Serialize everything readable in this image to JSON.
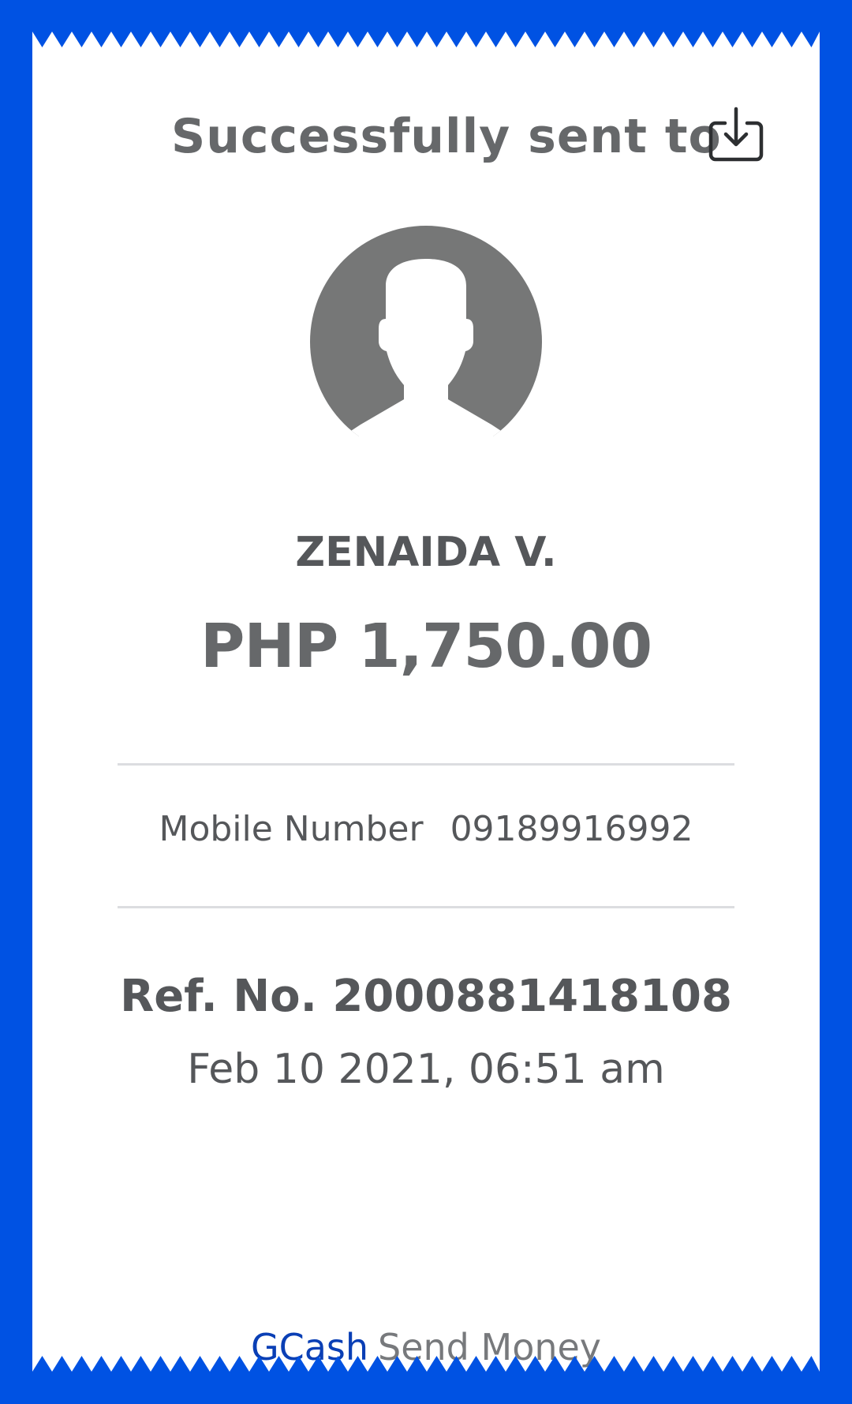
{
  "receipt": {
    "title": "Successfully sent to",
    "recipient_name": "ZENAIDA V.",
    "amount": "PHP 1,750.00",
    "mobile": {
      "label": "Mobile Number",
      "value": "09189916992"
    },
    "reference": "Ref. No. 2000881418108",
    "datetime": "Feb 10 2021, 06:51 am",
    "footer": {
      "brand": "GCash",
      "service": "Send Money"
    }
  },
  "icons": {
    "download": "download-icon",
    "avatar": "user-avatar-icon"
  },
  "colors": {
    "background": "#0052e3",
    "brand": "#0a3fb5",
    "text": "#55575a",
    "avatar": "#767777"
  }
}
